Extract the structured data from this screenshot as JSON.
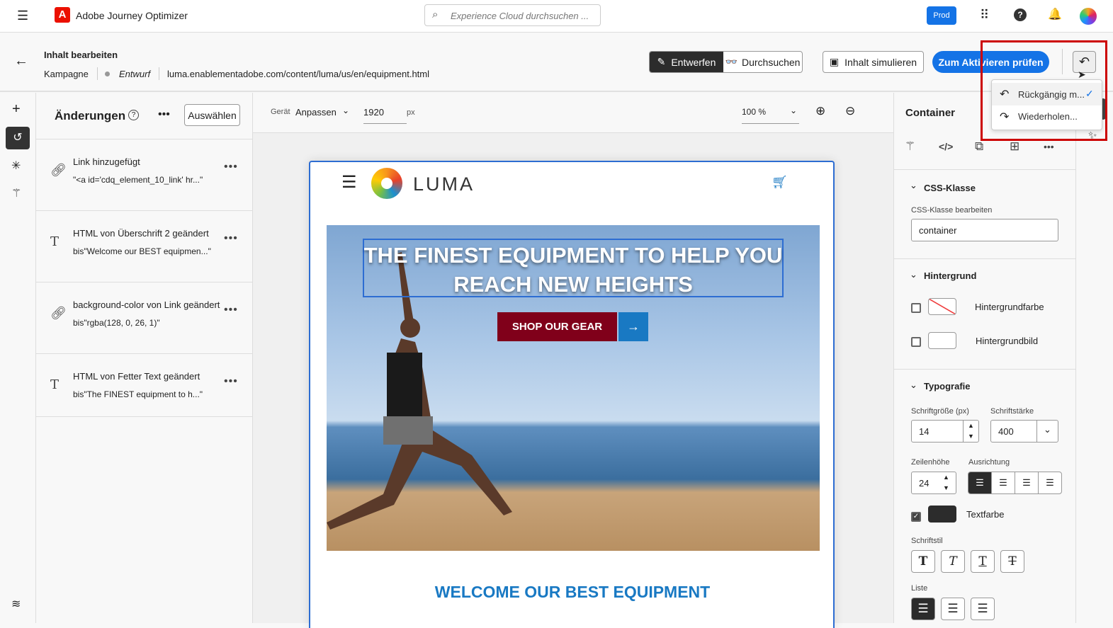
{
  "app": {
    "title": "Adobe Journey Optimizer",
    "search_placeholder": "Experience Cloud durchsuchen ...",
    "env_badge": "Prod"
  },
  "header": {
    "title": "Inhalt bearbeiten",
    "type": "Kampagne",
    "status": "Entwurf",
    "url": "luma.enablementadobe.com/content/luma/us/en/equipment.html",
    "mode_tabs": [
      {
        "label": "Entwerfen",
        "active": true
      },
      {
        "label": "Durchsuchen",
        "active": false
      }
    ],
    "simulate_label": "Inhalt simulieren",
    "activate_label": "Zum Aktivieren prüfen"
  },
  "undo_menu": {
    "items": [
      {
        "label": "Rückgängig m...",
        "checked": true
      },
      {
        "label": "Wiederholen..."
      }
    ]
  },
  "changes": {
    "title": "Änderungen",
    "select_label": "Auswählen",
    "items": [
      {
        "icon": "link-icon",
        "title": "Link hinzugefügt",
        "detail": "\"<a id='cdq_element_10_link' hr...\""
      },
      {
        "icon": "text-icon",
        "title": "HTML von Überschrift 2 geändert",
        "detail": "bis\"Welcome our BEST equipmen...\""
      },
      {
        "icon": "link-icon",
        "title": "background-color von Link geändert",
        "detail": "bis\"rgba(128, 0, 26, 1)\""
      },
      {
        "icon": "text-icon",
        "title": "HTML von Fetter Text geändert",
        "detail": "bis\"The FINEST equipment to h...\""
      }
    ]
  },
  "canvas": {
    "device_label": "Gerät",
    "device_value": "Anpassen",
    "width_value": "1920",
    "width_unit": "px",
    "zoom": "100 %"
  },
  "page": {
    "brand": "LUMA",
    "hero_title": "THE FINEST EQUIPMENT TO HELP YOU REACH NEW HEIGHTS",
    "cta": "SHOP OUR GEAR",
    "welcome": "WELCOME OUR BEST EQUIPMENT"
  },
  "props": {
    "title": "Container",
    "css": {
      "heading": "CSS-Klasse",
      "field_label": "CSS-Klasse bearbeiten",
      "value": "container"
    },
    "background": {
      "heading": "Hintergrund",
      "color_label": "Hintergrundfarbe",
      "image_label": "Hintergrundbild"
    },
    "typo": {
      "heading": "Typografie",
      "size_label": "Schriftgröße (px)",
      "size": "14",
      "weight_label": "Schriftstärke",
      "weight": "400",
      "lineheight_label": "Zeilenhöhe",
      "lineheight": "24",
      "align_label": "Ausrichtung",
      "textcolor_label": "Textfarbe",
      "textcolor": "#2c2c2c",
      "style_label": "Schriftstil",
      "list_label": "Liste"
    }
  },
  "colors": {
    "accent": "#1473e6",
    "adobe_red": "#eb1000",
    "cta": "#80001a",
    "highlight": "#cc0000",
    "heading_blue": "#1979c3"
  }
}
